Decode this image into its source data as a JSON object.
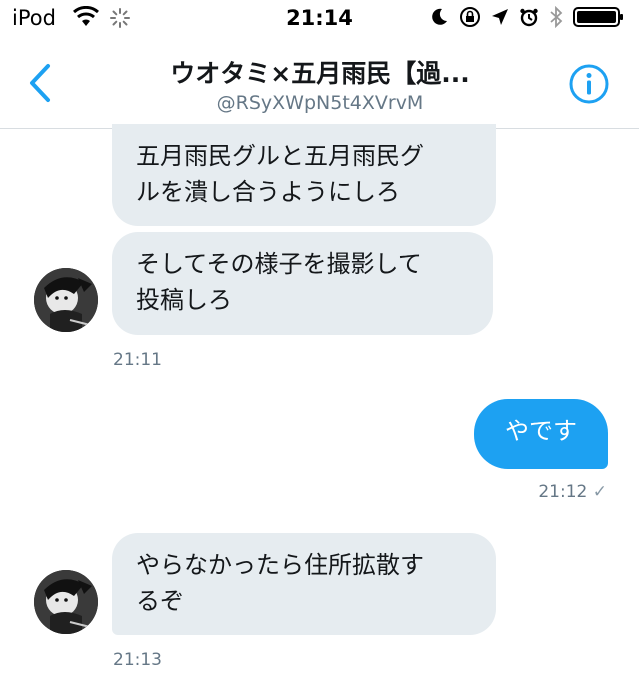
{
  "status_bar": {
    "carrier": "iPod",
    "time": "21:14"
  },
  "header": {
    "title": "ウオタミ×五月雨民【過...",
    "handle": "@RSyXWpN5t4XVrvM"
  },
  "messages": [
    {
      "text_lines": [
        "五月雨民グルと五月雨民グ",
        "ルを潰し合うようにしろ"
      ]
    },
    {
      "text_lines": [
        "そしてその様子を撮影して",
        "投稿しろ"
      ]
    },
    {
      "text_lines": [
        "やです"
      ]
    },
    {
      "text_lines": [
        "やらなかったら住所拡散す",
        "るぞ"
      ]
    }
  ],
  "timestamps": {
    "t1": "21:11",
    "t2": "21:12",
    "t2_read": "✓",
    "t3": "21:13"
  },
  "colors": {
    "accent": "#1da1f2",
    "bubble_received": "#e6ecf0",
    "muted_text": "#657786"
  },
  "icons": [
    "wifi-icon",
    "loading-spinner-icon",
    "moon-icon",
    "rotation-lock-icon",
    "location-arrow-icon",
    "alarm-icon",
    "bluetooth-icon",
    "battery-icon",
    "back-chevron-icon",
    "info-icon"
  ]
}
